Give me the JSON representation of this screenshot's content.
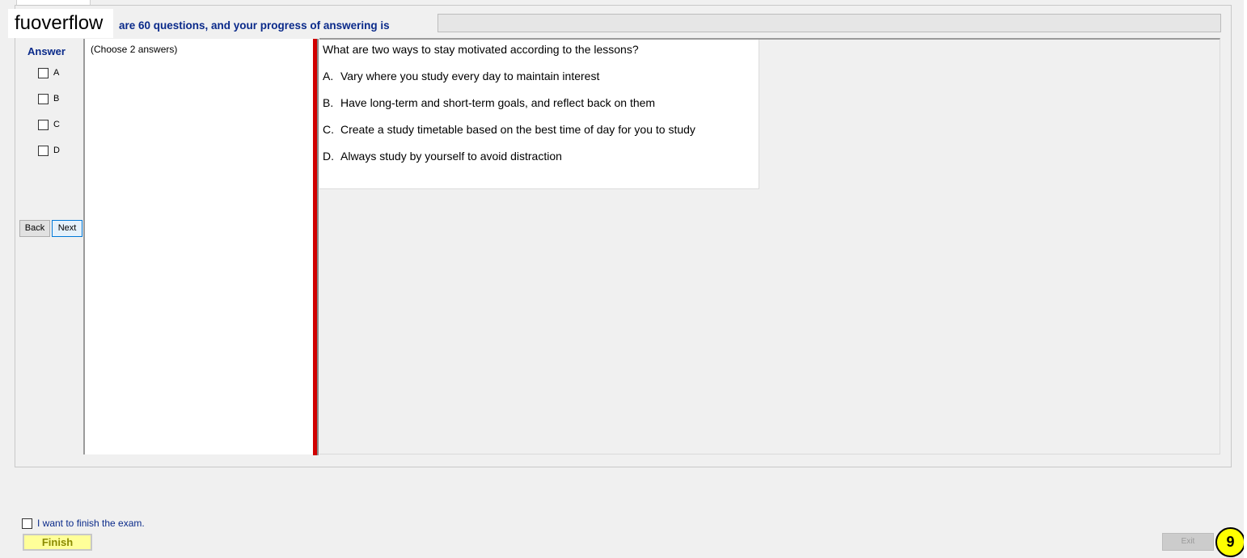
{
  "watermark": "fuoverflow",
  "header": {
    "progress_text": "are 60 questions, and your progress of answering is",
    "progress_fraction": 0
  },
  "answer": {
    "title": "Answer",
    "options": [
      "A",
      "B",
      "C",
      "D"
    ]
  },
  "nav": {
    "back_label": "Back",
    "next_label": "Next"
  },
  "instruction": "(Choose 2 answers)",
  "question": {
    "text": "What are two ways to stay motivated according to the lessons?",
    "choices": [
      {
        "letter": "A.",
        "text": "Vary where you study every day to maintain interest"
      },
      {
        "letter": "B.",
        "text": "Have long-term and short-term goals, and reflect back on them"
      },
      {
        "letter": "C.",
        "text": "Create a study timetable based on the best time of day for you to study"
      },
      {
        "letter": "D.",
        "text": "Always study by yourself to avoid distraction"
      }
    ]
  },
  "footer": {
    "finish_check_label": "I want to finish the exam.",
    "finish_button_label": "Finish",
    "exit_button_label": "Exit",
    "badge": "9"
  },
  "colors": {
    "accent_text": "#0a2a8a",
    "splitter": "#d10000",
    "finish_button": "#ffff99",
    "badge": "#ffff00"
  }
}
